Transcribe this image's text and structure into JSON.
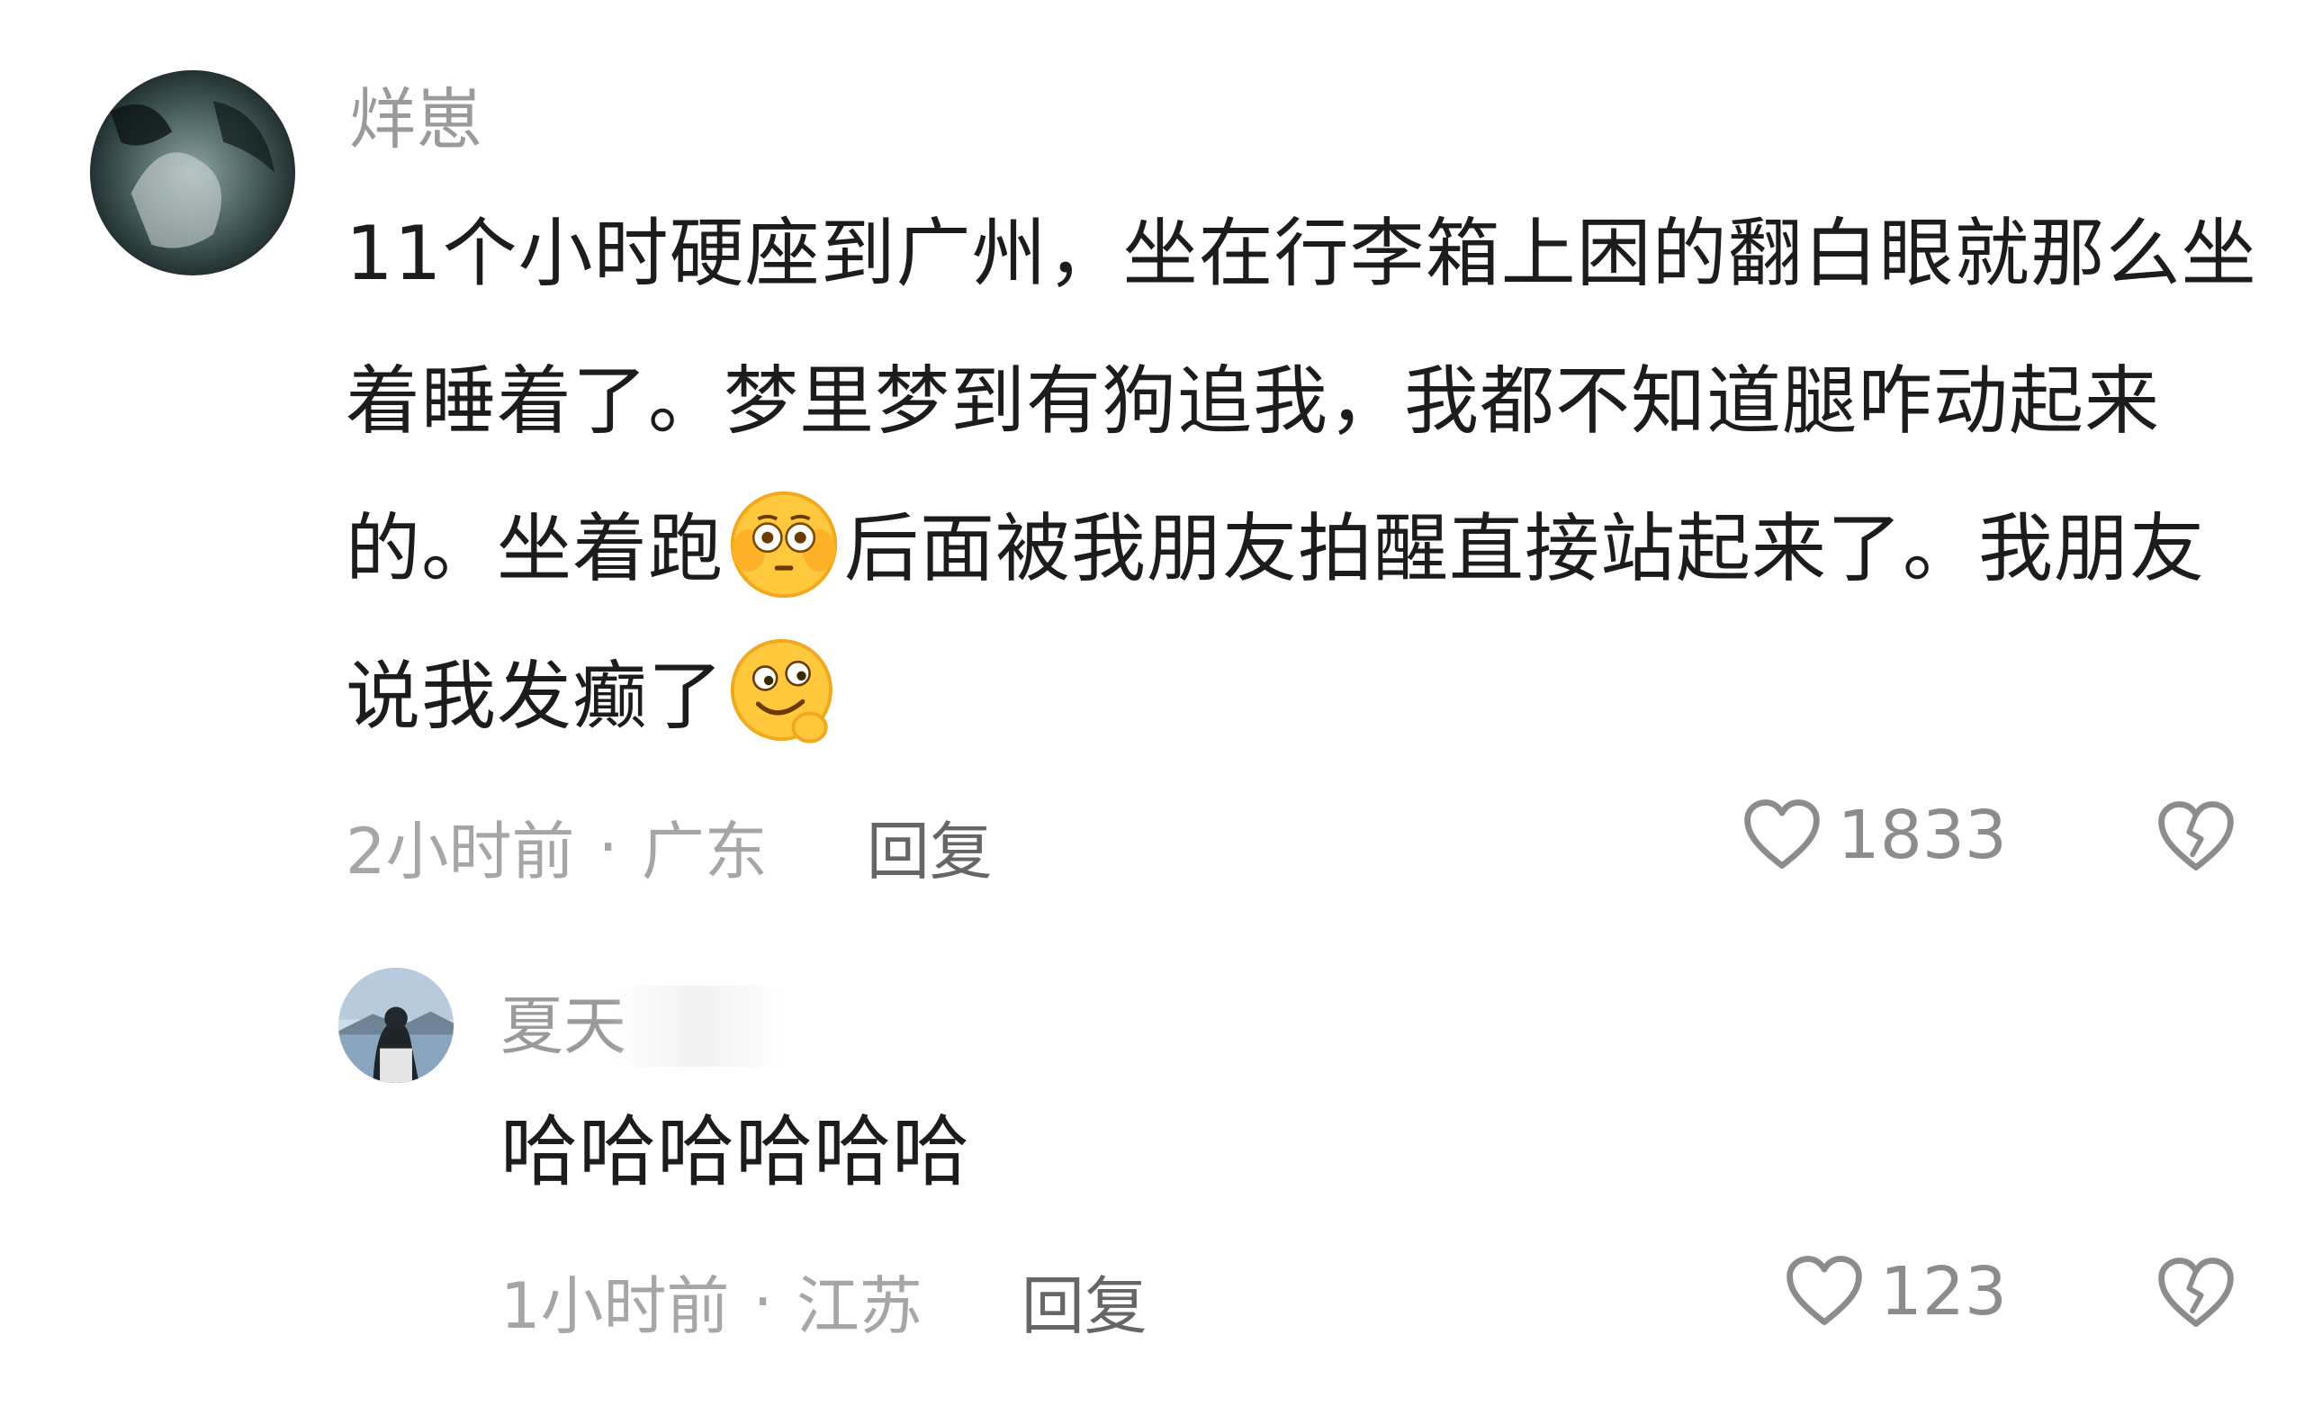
{
  "comments": [
    {
      "username": "烊崽",
      "content_parts": [
        "11个小时硬座到广州，坐在行李箱上困的翻白眼就那么坐着睡着了。梦里梦到有狗追我，我都不知道腿咋动起来的。坐着跑",
        "后面被我朋友拍醒直接站起来了。我朋友说我发癫了"
      ],
      "emojis": [
        "flushed-face-emoji",
        "smirk-thinking-emoji"
      ],
      "time": "2小时前",
      "separator": "·",
      "location": "广东",
      "reply_label": "回复",
      "like_count": "1833"
    },
    {
      "username": "夏天",
      "content": "哈哈哈哈哈哈",
      "time": "1小时前",
      "separator": "·",
      "location": "江苏",
      "reply_label": "回复",
      "like_count": "123"
    }
  ],
  "icons": {
    "like": "heart-outline-icon",
    "dislike": "broken-heart-outline-icon"
  },
  "colors": {
    "username": "#9a9a9a",
    "meta": "#a6a6a6",
    "reply": "#666666",
    "icon": "#8c8c8c",
    "text": "#1c1c1c"
  }
}
